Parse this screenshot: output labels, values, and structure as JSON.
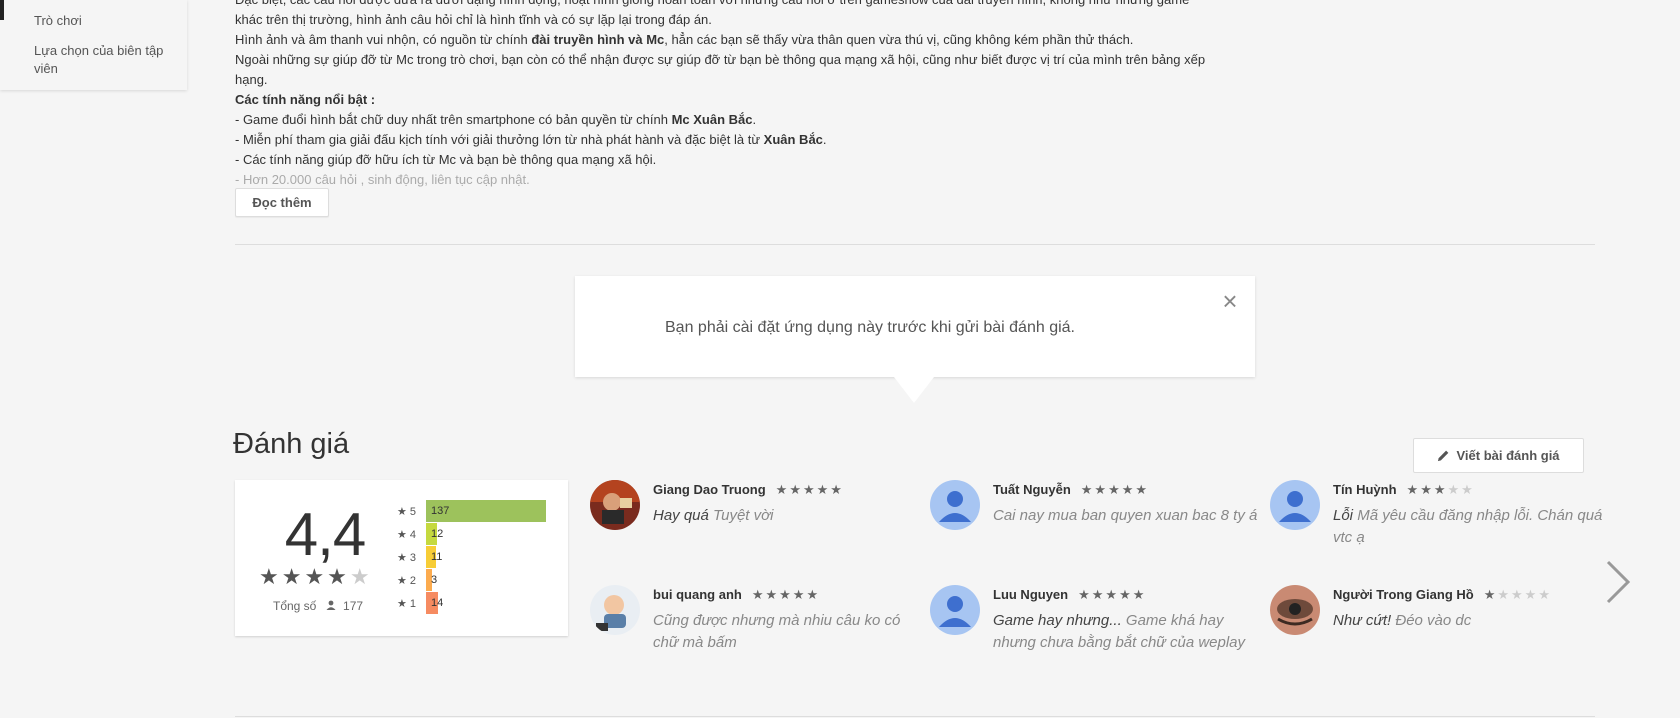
{
  "sidebar": {
    "items": [
      {
        "label": "Trò chơi"
      },
      {
        "label": "Lựa chọn của biên tập viên"
      }
    ]
  },
  "description": {
    "line0": "Đặc biệt, các câu hỏi được đưa ra dưới dạng hình động, hoạt hình giống hoàn toàn với những câu hỏi ở trên gameshow của đài truyền hình, không như những game",
    "line1": "khác trên thị trường, hình ảnh câu hỏi chỉ là hình tĩnh và có sự lặp lại trong đáp án.",
    "line2_a": "Hình ảnh và âm thanh vui nhộn, có nguồn từ chính ",
    "line2_b": "đài truyền hình và Mc",
    "line2_c": ", hẳn các bạn sẽ thấy vừa thân quen vừa thú vị, cũng không kém phần thử thách.",
    "line3": "Ngoài những sự giúp đỡ từ Mc trong trò chơi, bạn còn có thể nhận được sự giúp đỡ từ bạn bè thông qua mạng xã hội, cũng như biết được vị trí của mình trên bảng xếp",
    "line4": "hạng.",
    "features_title": "Các tính năng nổi bật :",
    "feature1_a": "- Game đuổi hình bắt chữ duy nhất trên smartphone có bản quyền từ chính ",
    "feature1_b": "Mc Xuân Bắc",
    "feature1_c": ".",
    "feature2_a": "- Miễn phí tham gia giải đấu kịch tính với giải thưởng lớn từ nhà phát hành và đặc biệt là từ ",
    "feature2_b": "Xuân Bắc",
    "feature2_c": ".",
    "feature3": "- Các tính năng giúp đỡ hữu ích từ Mc và bạn bè thông qua mạng xã hội.",
    "feature4": "- Hơn 20.000 câu hỏi , sinh động, liên tục cập nhật.",
    "read_more": "Đọc thêm"
  },
  "notice": {
    "text": "Bạn phải cài đặt ứng dụng này trước khi gửi bài đánh giá.",
    "close_glyph": "×"
  },
  "reviews_section": {
    "title": "Đánh giá",
    "write_review": "Viết bài đánh giá"
  },
  "rating": {
    "score": "4,4",
    "total_label": "Tổng số",
    "total": "177",
    "histogram": [
      {
        "star": "5",
        "count": "137",
        "fraction": 1.0,
        "color": "#9dc25c"
      },
      {
        "star": "4",
        "count": "12",
        "fraction": 0.09,
        "color": "#c5d93f"
      },
      {
        "star": "3",
        "count": "11",
        "fraction": 0.08,
        "color": "#f7cd36"
      },
      {
        "star": "2",
        "count": "3",
        "fraction": 0.02,
        "color": "#fcab4e"
      },
      {
        "star": "1",
        "count": "14",
        "fraction": 0.1,
        "color": "#f68b61"
      }
    ]
  },
  "reviews": [
    {
      "name": "Giang Dao Truong",
      "stars": 5,
      "title": "Hay quá",
      "body": "Tuyệt vời",
      "avatar": "photo-red"
    },
    {
      "name": "Tuất Nguyễn",
      "stars": 5,
      "title": "",
      "body": "Cai nay mua ban quyen xuan bac 8 ty á",
      "avatar": "default"
    },
    {
      "name": "Tín Huỳnh",
      "stars": 3,
      "title": "Lỗi",
      "body": "Mã yêu cầu đăng nhập lỗi. Chán quá vtc ạ",
      "avatar": "default"
    },
    {
      "name": "bui quang anh",
      "stars": 5,
      "title": "",
      "body": "Cũng được nhưng mà nhiu câu ko có chữ mà bấm",
      "avatar": "photo-baby"
    },
    {
      "name": "Luu Nguyen",
      "stars": 5,
      "title": "Game hay nhưng...",
      "body": "Game khá hay nhưng chưa bằng bắt chữ của weplay",
      "avatar": "default"
    },
    {
      "name": "Người Trong Giang Hồ",
      "stars": 1,
      "title": "Như cứt!",
      "body": "Đéo vào dc",
      "avatar": "photo-eye"
    }
  ]
}
